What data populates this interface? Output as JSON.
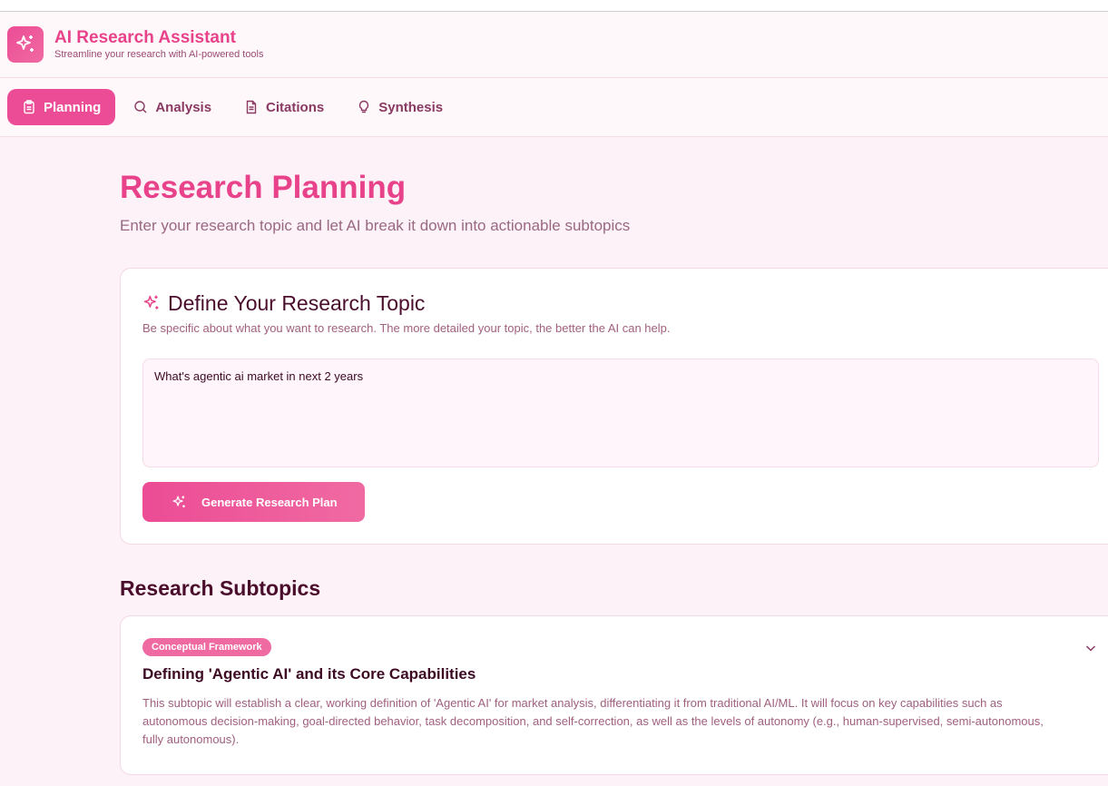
{
  "app": {
    "title": "AI Research Assistant",
    "subtitle": "Streamline your research with AI-powered tools",
    "logo_icon": "sparkles-icon"
  },
  "tabs": [
    {
      "label": "Planning",
      "icon": "clipboard-icon",
      "active": true
    },
    {
      "label": "Analysis",
      "icon": "search-icon",
      "active": false
    },
    {
      "label": "Citations",
      "icon": "document-icon",
      "active": false
    },
    {
      "label": "Synthesis",
      "icon": "lightbulb-icon",
      "active": false
    }
  ],
  "page": {
    "title": "Research Planning",
    "description": "Enter your research topic and let AI break it down into actionable subtopics"
  },
  "topic_card": {
    "title": "Define Your Research Topic",
    "description": "Be specific about what you want to research. The more detailed your topic, the better the AI can help.",
    "input_value": "What's agentic ai market in next 2 years",
    "button_label": "Generate Research Plan"
  },
  "subtopics": {
    "title": "Research Subtopics",
    "items": [
      {
        "badge": "Conceptual Framework",
        "title": "Defining 'Agentic AI' and its Core Capabilities",
        "description": "This subtopic will establish a clear, working definition of 'Agentic AI' for market analysis, differentiating it from traditional AI/ML. It will focus on key capabilities such as autonomous decision-making, goal-directed behavior, task decomposition, and self-correction, as well as the levels of autonomy (e.g., human-supervised, semi-autonomous, fully autonomous)."
      }
    ]
  },
  "colors": {
    "accent": "#ec4c95",
    "background": "#fdf2f7",
    "heading": "#4a0d2b"
  }
}
